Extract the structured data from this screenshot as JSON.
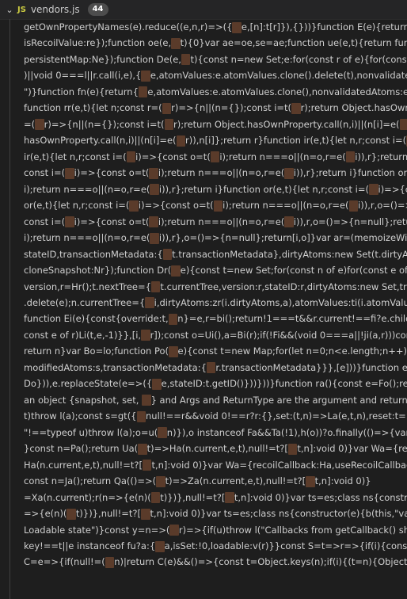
{
  "tab": {
    "chevron_icon": "chevron-down-icon",
    "icon_text": "JS",
    "title": "vendors.js",
    "problems_badge": "44"
  },
  "colors": {
    "editor_bg": "#1e1e1e",
    "tab_bg": "#252526",
    "js_icon": "#cbcb41",
    "masked_glyph": "#5a3b2a"
  },
  "lines": [
    "getOwnPropertyNames(e).reduce((e,n,r)=>({…e,[n]:t[r]}),{}))}function E(e){return e insta",
    "isRecoilValue:re});function oe(e,…t){0}var ae=oe,se=ae;function ue(e,t){return function",
    "persistentMap:Ne});function De(e,…t){const n=new Set;e:for(const r of e){for(const e o",
    ")||void 0===l||r.call(i,e),{…e,atomValues:e.atomValues.clone().delete(t),nonvalidatedAtom",
    "\")}function fn(e){return{…e,atomValues:e.atomValues.clone(),nonvalidatedAtoms:e.nor",
    "function rr(e,t){let n;const r=(…r)=>{n||(n={});const i=t(…r);return Object.hasOwnProper",
    "=(…r)=>{n||(n={});const i=t(…r);return Object.hasOwnProperty.call(n,i)||(n[i]=e(…r)),n[i]}",
    "hasOwnProperty.call(n,i)||(n[i]=e(…r)),n[i]};return r}function ir(e,t){let n,r;const i=(…i)=>",
    "ir(e,t){let n,r;const i=(…i)=>{const o=t(…i);return n===o||(n=o,r=e(…i)),r};return i}functio",
    "const i=(…i)=>{const o=t(…i);return n===o||(n=o,r=e(…i)),r};return i}function or(e,t){le",
    "i);return n===o||(n=o,r=e(…i)),r};return i}function or(e,t){let n,r;const i=(…i)=>{const o",
    "or(e,t){let n,r;const i=(…i)=>{const o=t(…i);return n===o||(n=o,r=e(…i)),r,o=()=>{n=nu",
    "const i=(…i)=>{const o=t(…i);return n===o||(n=o,r=e(…i)),r,o=()=>{n=null};return[i,o]",
    "i);return n===o||(n=o,r=e(…i)),r},o=()=>{n=null};return[i,o]}var ar=(memoizeWithArgs",
    "stateID,transactionMetadata:{…t.transactionMetadata},dirtyAtoms:new Set(t.dirtyAtom",
    "cloneSnapshot:Nr});function Dr(…e){const t=new Set;for(const n of e)for(const e of n)t",
    "version,r=Hr();t.nextTree={…t.currentTree,version:r,stateID:r,dirtyAtoms:new Set,transac",
    ".delete(e);n.currentTree={…i,dirtyAtoms:zr(i.dirtyAtoms,a),atomValues:ti(i.atomValues,o",
    "function Ei(e){const{override:t,…n}=e,r=bi();return!1===t&&r.current!==fi?e.children:a",
    "const e of r)Li(t,e,-1)}},[i,…r]);const o=Ui(),a=Bi(r);if(!Fi&&(void 0===a||!ji(a,r)))const t",
    "return n}var Bo=lo;function Po(…e){const t=new Map;for(let n=0;n<e.length;n++){const",
    "modifiedAtoms:s,transactionMetadata:{…r.transactionMetadata}}},[e]))}function ea(e){",
    "Do})),e.replaceState(e=>({…e,stateID:t.getID()}))}))}function ra(){const e=Fo();return $o(",
    "an object {snapshot, set, …} and Args and ReturnType are the argument and return typ",
    "t)throw l(a);const s=gt({…null!==r&&void 0!==r?r:{},set:(t,n)=>La(e,t,n),reset:t=>La(e,t",
    "\"!==typeof u)throw l(a);o=u(…n)}),o instanceof Fa&&Ta(!1),h(o))?o.finally(()=>{var e;nu",
    "}const n=Pa();return Ua(…t)=>Ha(n.current,e,t),null!=t?[…t,n]:void 0)}var Wa={recoilCal",
    "Ha(n.current,e,t),null!=t?[…t,n]:void 0)}var Wa={recoilCallback:Ha,useRecoilCallback:Va",
    "const n=Ja();return Qa(()=>(…t)=>Za(n.current,e,t),null!=t?[…t,n]:void 0)}",
    "=Xa(n.current);r(n=>{e(n)(…t)})},null!=t?[…t,n]:void 0)}var ts=es;class ns{constructor(e)",
    "=>{e(n)(…t)})},null!=t?[…t,n]:void 0)}var ts=es;class ns{constructor(e){b(this,\"value\",void",
    "Loadable state\")}const y=n=>(…r)=>{if(u)throw l(\"Callbacks from getCallback() should",
    "key!==t||e instanceof fu?a:{…a,isSet:!0,loadable:v(r)}}const S=t=>r=>{if(i){const n=v(w",
    "C=e=>{if(null!=(…n)|return C(e)&&()=>{const t=Object.keys(n);if(i){(t=n){Object"
  ]
}
